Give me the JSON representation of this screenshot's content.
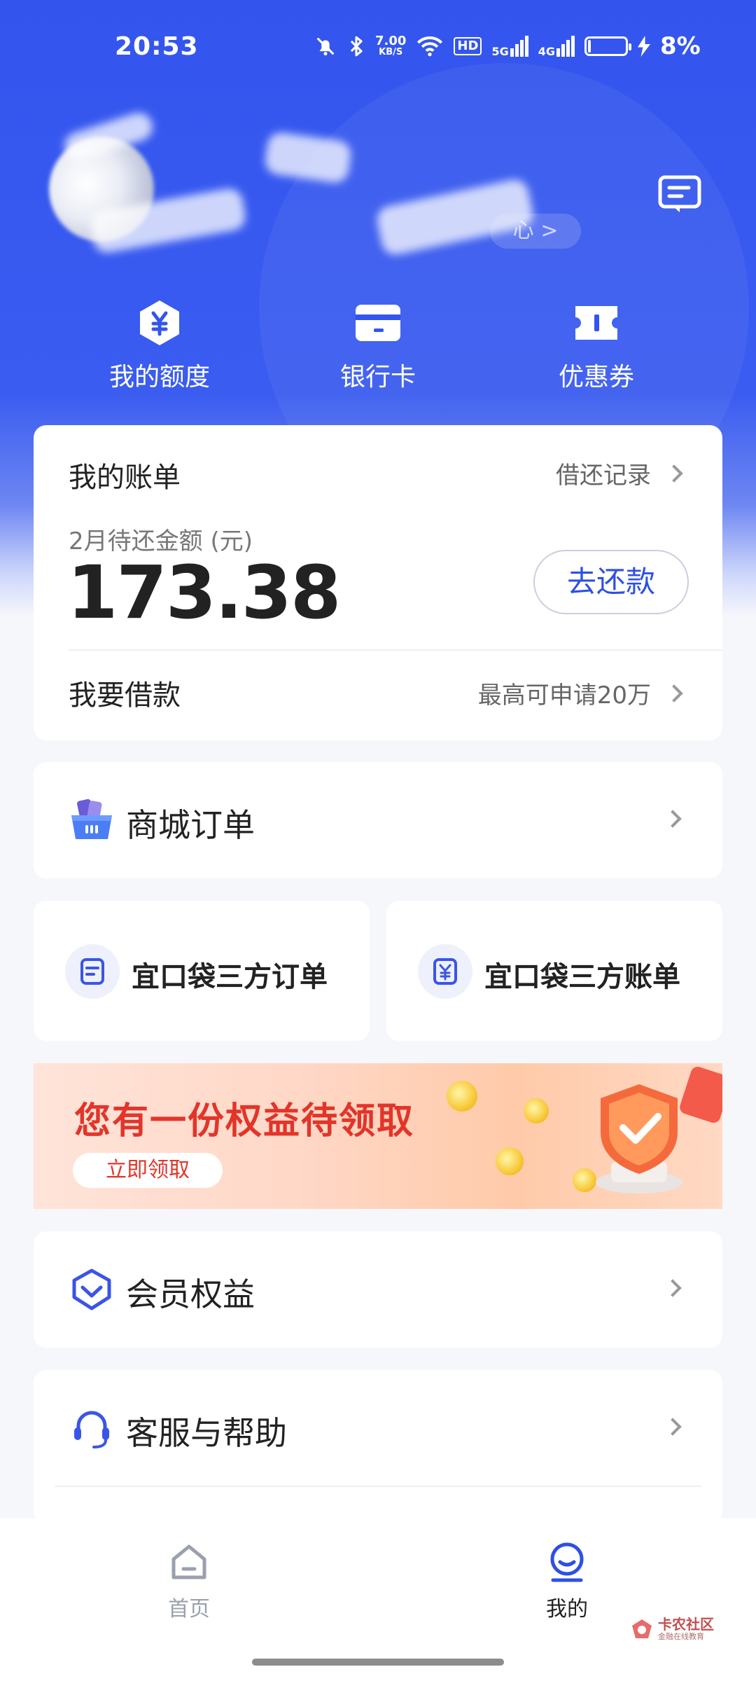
{
  "status_bar": {
    "time": "20:53",
    "net_speed_value": "7.00",
    "net_speed_unit": "KB/S",
    "hd_label": "HD",
    "signal_5g": "5G",
    "signal_4g": "4G",
    "battery_percent": "8%",
    "battery_level": 0.08
  },
  "header": {
    "profile_link_text": "心 >",
    "quick_actions": [
      {
        "label": "我的额度",
        "icon": "yuan-hexagon-icon"
      },
      {
        "label": "银行卡",
        "icon": "bank-card-icon"
      },
      {
        "label": "优惠券",
        "icon": "coupon-icon"
      }
    ]
  },
  "bill_card": {
    "title": "我的账单",
    "history_link": "借还记录",
    "due_label": "2月待还金额 (元)",
    "amount": "173.38",
    "repay_button": "去还款",
    "loan_label": "我要借款",
    "loan_note": "最高可申请20万"
  },
  "mall_orders": {
    "label": "商城订单",
    "icon": "shopping-basket-icon"
  },
  "third_party": {
    "orders_label": "宜口袋三方订单",
    "bills_label": "宜口袋三方账单"
  },
  "banner": {
    "title": "您有一份权益待领取",
    "button": "立即领取"
  },
  "member": {
    "label": "会员权益",
    "icon": "member-badge-icon"
  },
  "help": {
    "label": "客服与帮助",
    "icon": "headset-icon"
  },
  "tabbar": {
    "home_label": "首页",
    "mine_label": "我的",
    "active_color": "#2e4fe6",
    "inactive_color": "#9aa0ad"
  },
  "watermark": {
    "main": "卡农社区",
    "sub": "金融在线教育"
  },
  "colors": {
    "brand_blue": "#3355ee",
    "accent_red": "#e2352a"
  }
}
